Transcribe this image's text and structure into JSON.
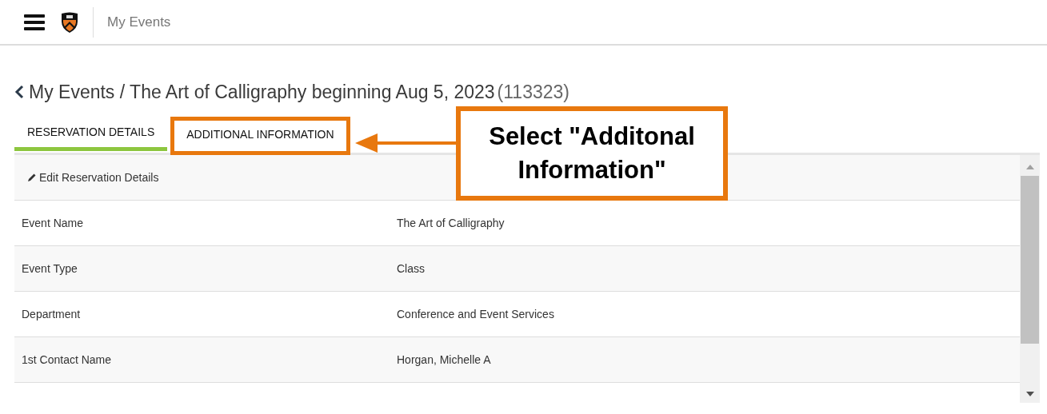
{
  "header": {
    "title": "My Events"
  },
  "breadcrumb": {
    "path": "My Events / The Art of Calligraphy beginning Aug 5, 2023",
    "id": "(113323)"
  },
  "tabs": [
    {
      "label": "RESERVATION DETAILS",
      "selected": true
    },
    {
      "label": "ADDITIONAL INFORMATION",
      "selected": false,
      "highlighted": true
    }
  ],
  "edit_link": "Edit Reservation Details",
  "rows": [
    {
      "label": "Event Name",
      "value": "The Art of Calligraphy"
    },
    {
      "label": "Event Type",
      "value": "Class"
    },
    {
      "label": "Department",
      "value": "Conference and Event Services"
    },
    {
      "label": "1st Contact Name",
      "value": "Horgan, Michelle A"
    }
  ],
  "annotation": {
    "text": "Select \"Additonal Information\""
  }
}
